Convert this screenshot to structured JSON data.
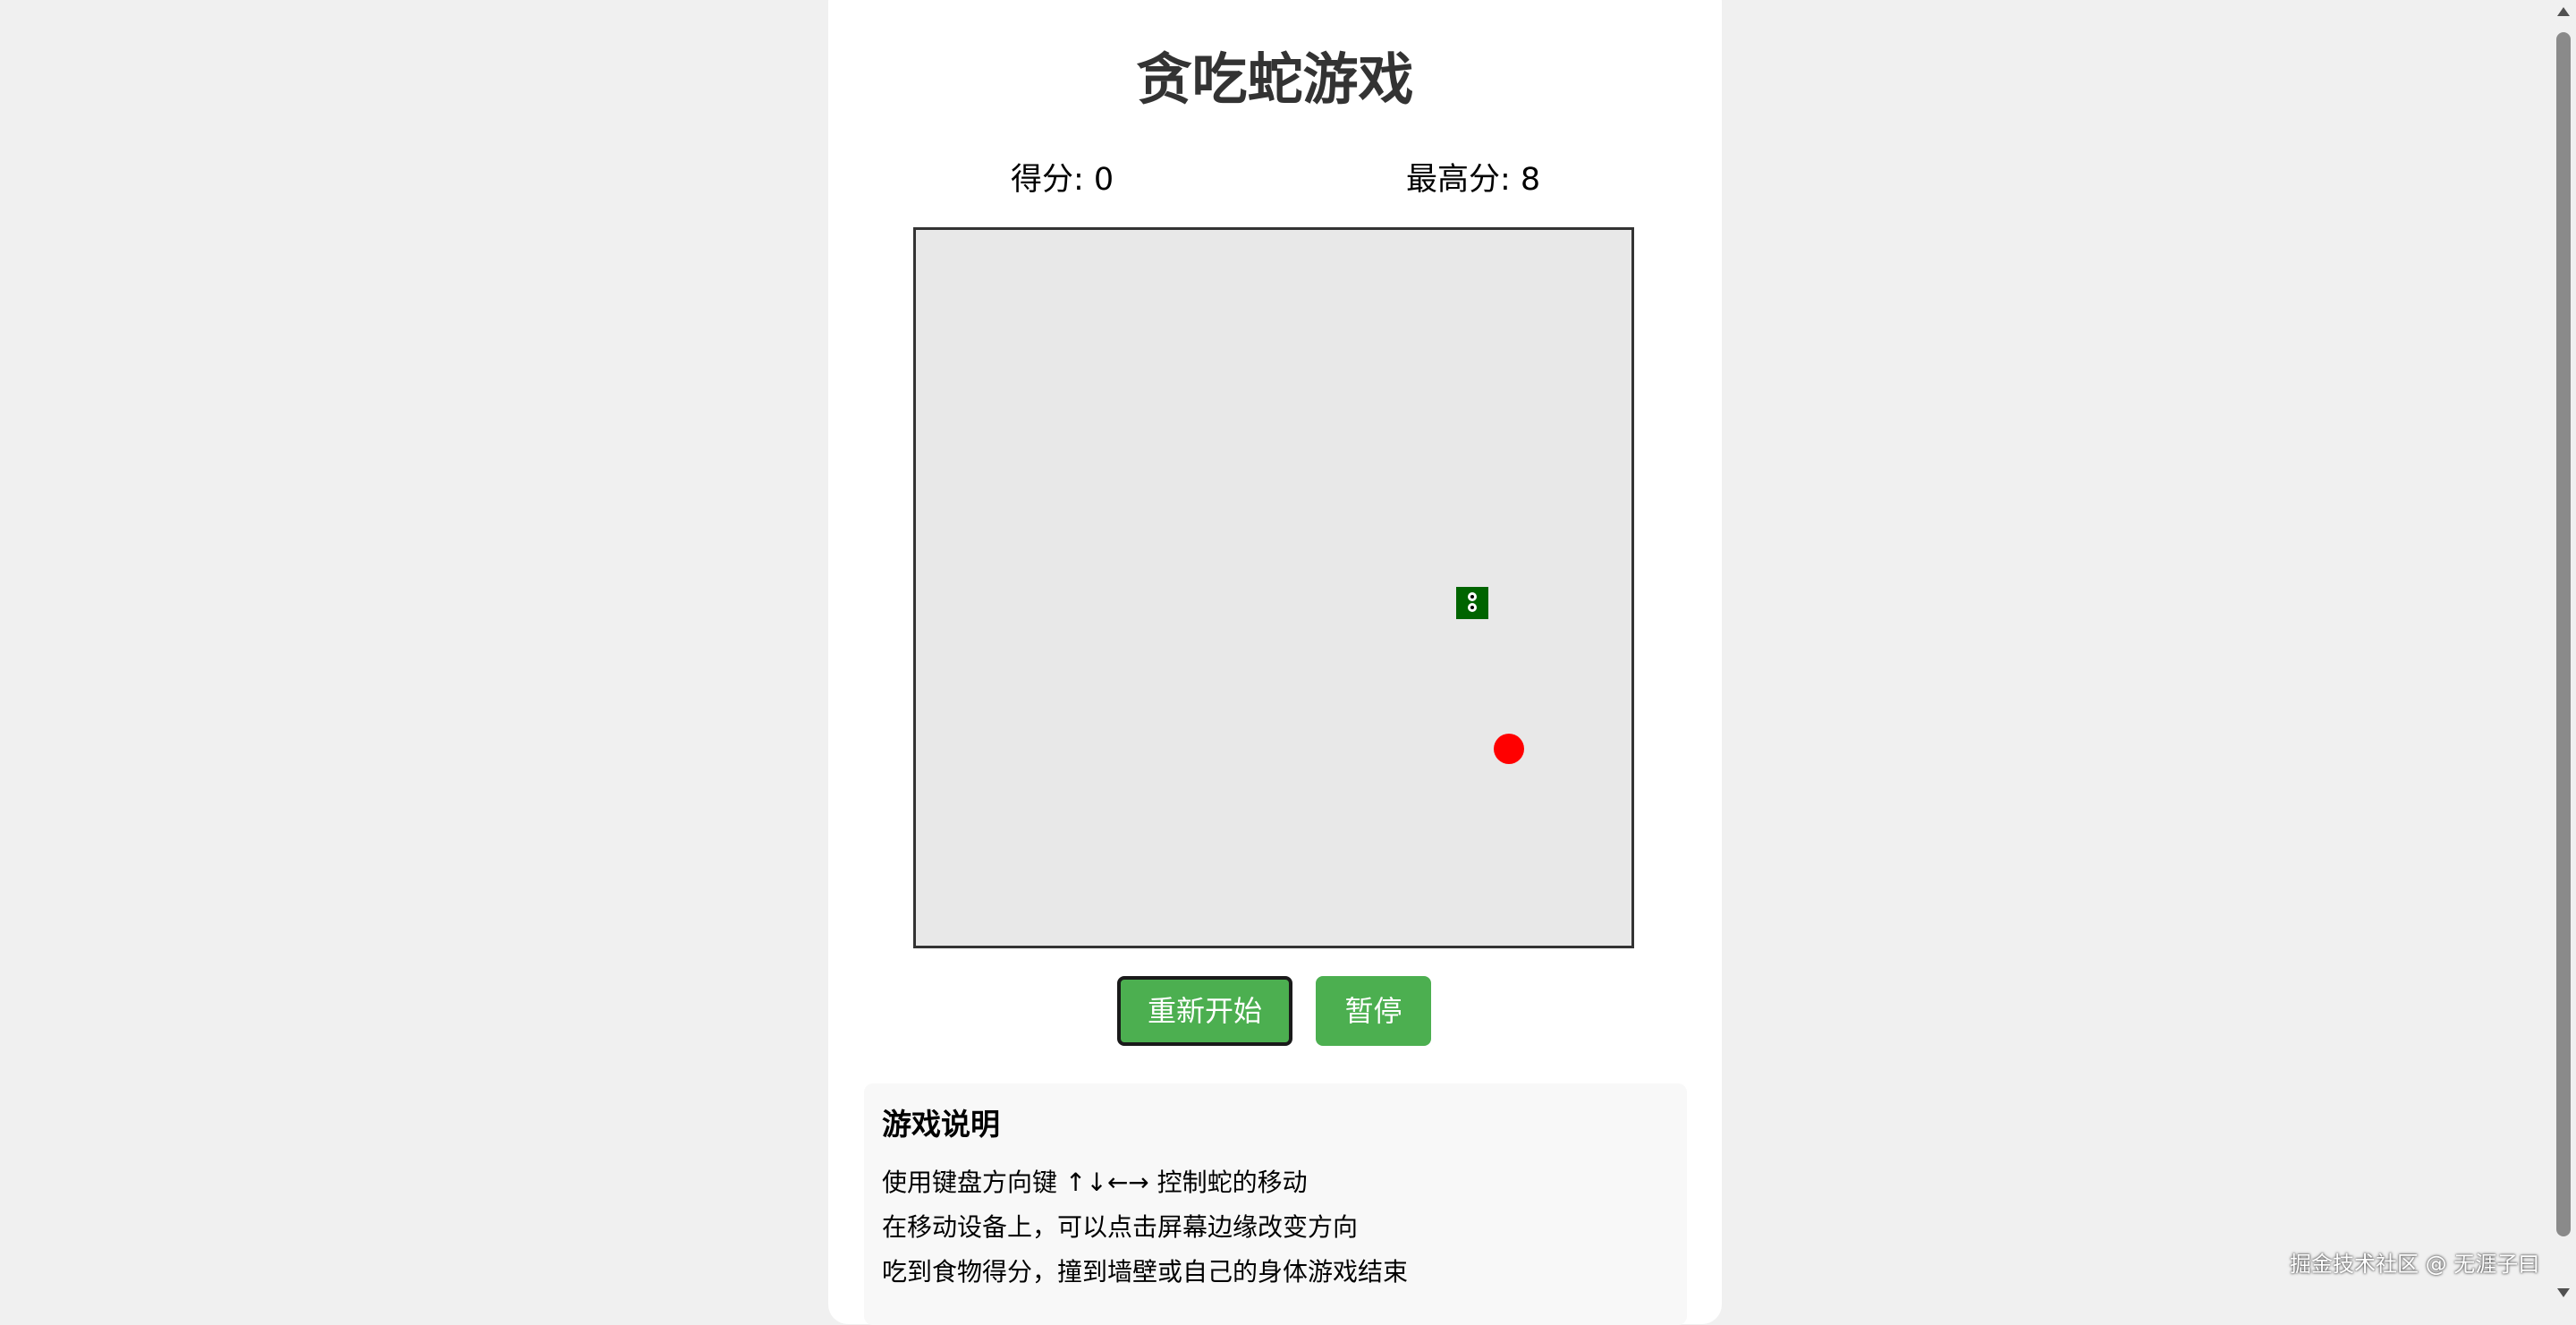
{
  "header": {
    "title": "贪吃蛇游戏"
  },
  "scores": {
    "score_text": "得分: 0",
    "high_score_text": "最高分: 8"
  },
  "game": {
    "board_color": "#e8e8e8",
    "snake_color": "#006400",
    "food_color": "#ff0000",
    "snake_length": 1
  },
  "controls": {
    "restart_label": "重新开始",
    "pause_label": "暂停",
    "button_color": "#4caf50"
  },
  "instructions": {
    "title": "游戏说明",
    "lines": [
      "使用键盘方向键 ↑↓←→ 控制蛇的移动",
      "在移动设备上，可以点击屏幕边缘改变方向",
      "吃到食物得分，撞到墙壁或自己的身体游戏结束"
    ]
  },
  "watermark": {
    "text": "掘金技术社区 @ 无涯子曰"
  }
}
